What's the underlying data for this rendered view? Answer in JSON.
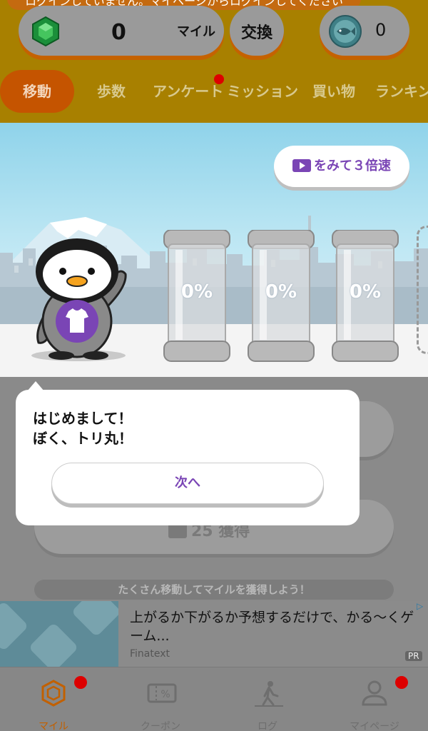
{
  "header": {
    "login_notice": "ログインしていません。マイページからログインしてください",
    "miles_count": "0",
    "miles_unit": "マイル",
    "exchange_label": "交換",
    "fish_count": "0"
  },
  "nav_tabs": [
    {
      "label": "移動",
      "active": true
    },
    {
      "label": "歩数"
    },
    {
      "label": "アンケート",
      "badge": true
    },
    {
      "label": "ミッション"
    },
    {
      "label": "買い物"
    },
    {
      "label": "ランキング"
    }
  ],
  "scene": {
    "speed_button": "をみて３倍速",
    "jars": [
      {
        "fill_percent": "0%"
      },
      {
        "fill_percent": "0%"
      },
      {
        "fill_percent": "0%"
      }
    ]
  },
  "main": {
    "acquire_text": "25 獲得",
    "hint": "たくさん移動してマイルを獲得しよう！"
  },
  "dialog": {
    "line1": "はじめまして！",
    "line2": "ぼく、トリ丸！",
    "next_button": "次へ"
  },
  "ad": {
    "text": "上がるか下がるか予想するだけで、かる〜くゲーム...",
    "advertiser": "Finatext",
    "pr_label": "PR"
  },
  "tab_bar": [
    {
      "label": "マイル",
      "icon": "gem-icon",
      "active": true,
      "badge": true
    },
    {
      "label": "クーポン",
      "icon": "coupon-icon"
    },
    {
      "label": "ログ",
      "icon": "walk-log-icon"
    },
    {
      "label": "マイページ",
      "icon": "user-icon",
      "badge": true
    }
  ],
  "colors": {
    "header_bg": "#a88000",
    "accent_orange": "#c55400",
    "accent_purple": "#7a45b5",
    "badge_red": "#dd0000"
  }
}
